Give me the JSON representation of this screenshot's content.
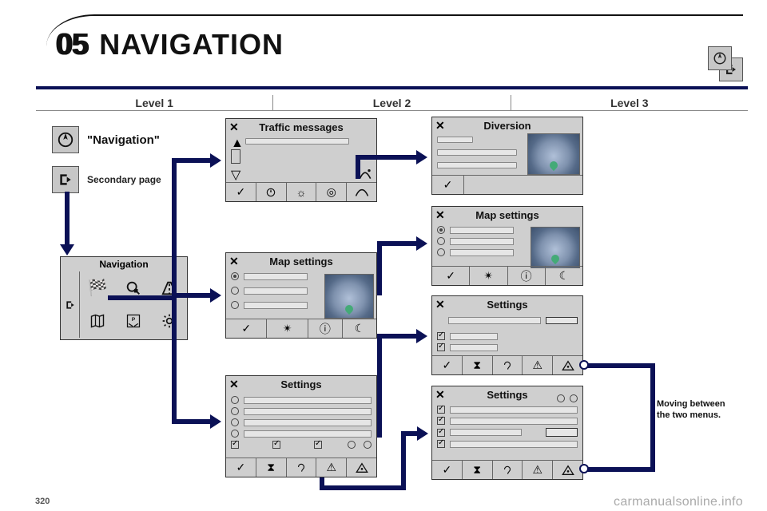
{
  "section": {
    "number": "05",
    "title": "NAVIGATION"
  },
  "columns": {
    "l1": "Level 1",
    "l2": "Level 2",
    "l3": "Level 3"
  },
  "legend": {
    "nav_label": "\"Navigation\"",
    "secondary_label": "Secondary page"
  },
  "nav_card": {
    "title": "Navigation"
  },
  "cards": {
    "traffic": {
      "title": "Traffic messages"
    },
    "mapset_l2": {
      "title": "Map settings"
    },
    "settings_l2": {
      "title": "Settings"
    },
    "diversion": {
      "title": "Diversion"
    },
    "mapset_l3": {
      "title": "Map settings"
    },
    "settings_l3a": {
      "title": "Settings"
    },
    "settings_l3b": {
      "title": "Settings"
    }
  },
  "side_note": "Moving between the two menus.",
  "watermark": "carmanualsonline.info",
  "page_number": "320"
}
